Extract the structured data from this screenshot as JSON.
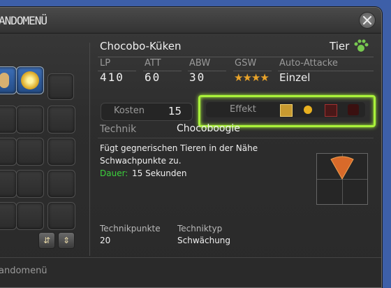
{
  "window": {
    "title": "ANDOMENÜ"
  },
  "pet": {
    "name": "Chocobo-Küken",
    "tier_label": "Tier"
  },
  "stats": {
    "lp_label": "LP",
    "lp_value": "410",
    "att_label": "ATT",
    "att_value": "60",
    "abw_label": "ABW",
    "abw_value": "30",
    "gsw_label": "GSW",
    "gsw_stars": "★★★★",
    "auto_label": "Auto-Attacke",
    "auto_value": "Einzel"
  },
  "cost": {
    "label": "Kosten",
    "value": "15"
  },
  "effect": {
    "label": "Effekt"
  },
  "technique": {
    "label": "Technik",
    "name": "Chocoboogie",
    "description_line1": "Fügt gegnerischen Tieren in der Nähe",
    "description_line2": "Schwachpunkte zu.",
    "duration_label": "Dauer:",
    "duration_value": "15 Sekunden",
    "points_label": "Technikpunkte",
    "points_value": "20",
    "type_label": "Techniktyp",
    "type_value": "Schwächung"
  },
  "footer": {
    "text": "andomenü"
  },
  "colors": {
    "highlight": "#a9f23a",
    "duration": "#3cd23c",
    "star": "#e8a32a",
    "tier_icon": "#78c850"
  }
}
